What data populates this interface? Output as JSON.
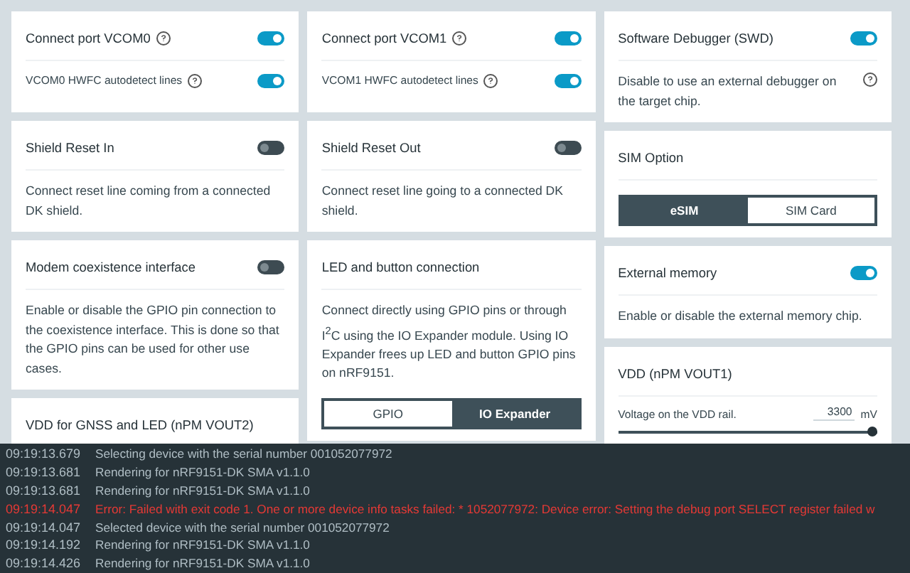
{
  "columns": [
    [
      {
        "title": "Connect port VCOM0",
        "title_help": true,
        "on": true,
        "rows": [
          {
            "label": "VCOM0 HWFC autodetect lines",
            "help": true,
            "on": true
          }
        ]
      },
      {
        "title": "Shield Reset In",
        "on": false,
        "description": "Connect reset line coming from a connected DK shield."
      },
      {
        "title": "Modem coexistence interface",
        "on": false,
        "description": "Enable or disable the GPIO pin connection to the coexistence interface. This is done so that the GPIO pins can be used for other use cases."
      },
      {
        "title": "VDD for GNSS and LED (nPM VOUT2)"
      }
    ],
    [
      {
        "title": "Connect port VCOM1",
        "title_help": true,
        "on": true,
        "rows": [
          {
            "label": "VCOM1 HWFC autodetect lines",
            "help": true,
            "on": true
          }
        ]
      },
      {
        "title": "Shield Reset Out",
        "on": false,
        "description": "Connect reset line going to a connected DK shield."
      },
      {
        "title": "LED and button connection",
        "description": "Connect directly using GPIO pins or through I$^{2}$C using the IO Expander module. Using IO Expander frees up LED and button GPIO pins on nRF9151.",
        "segments": [
          {
            "label": "GPIO",
            "selected": false
          },
          {
            "label": "IO Expander",
            "selected": true
          }
        ]
      }
    ],
    [
      {
        "title": "Software Debugger (SWD)",
        "on": true,
        "description": "Disable to use an external debugger on the target chip.",
        "description_help": true
      },
      {
        "title": "SIM Option",
        "segments": [
          {
            "label": "eSIM",
            "selected": true
          },
          {
            "label": "SIM Card",
            "selected": false
          }
        ]
      },
      {
        "title": "External memory",
        "on": true,
        "description": "Enable or disable the external memory chip."
      },
      {
        "title": "VDD (nPM VOUT1)",
        "slider": {
          "label": "Voltage on the VDD rail.",
          "value": "3300",
          "unit": "mV",
          "level": 1
        }
      }
    ]
  ],
  "log": [
    {
      "time": "09:19:13.679",
      "message": "Selecting device with the serial number 001052077972",
      "error": false
    },
    {
      "time": "09:19:13.681",
      "message": "Rendering for nRF9151-DK SMA v1.1.0",
      "error": false
    },
    {
      "time": "09:19:13.681",
      "message": "Rendering for nRF9151-DK SMA v1.1.0",
      "error": false
    },
    {
      "time": "09:19:14.047",
      "message": "Error: Failed with exit code 1. One or more device info tasks failed: * 1052077972: Device error: Setting the debug port SELECT register failed w",
      "error": true
    },
    {
      "time": "09:19:14.047",
      "message": "Selected device with the serial number 001052077972",
      "error": false
    },
    {
      "time": "09:19:14.192",
      "message": "Rendering for nRF9151-DK SMA v1.1.0",
      "error": false
    },
    {
      "time": "09:19:14.426",
      "message": "Rendering for nRF9151-DK SMA v1.1.0",
      "error": false
    }
  ]
}
